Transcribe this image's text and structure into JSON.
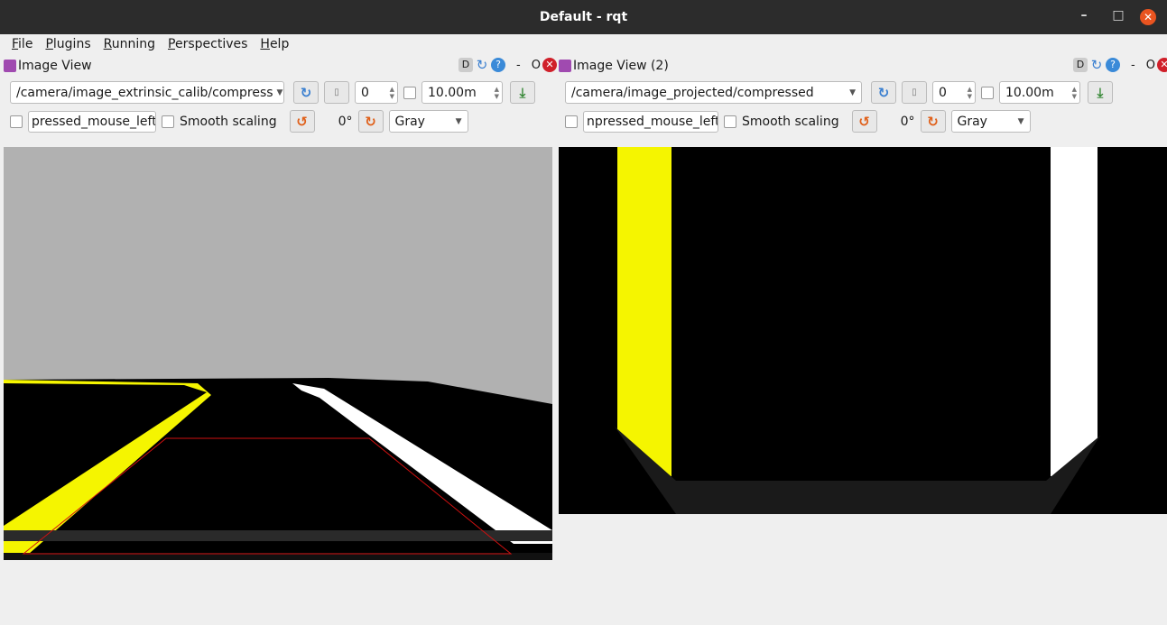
{
  "window": {
    "title": "Default - rqt",
    "minimize": "–",
    "maximize": "□",
    "close": "✕"
  },
  "menu": [
    "File",
    "Plugins",
    "Running",
    "Perspectives",
    "Help"
  ],
  "docks": [
    {
      "title": "Image View",
      "topic": "/camera/image_extrinsic_calib/compress",
      "spin_value": "0",
      "timeout": "10.00m",
      "mouse_topic": "pressed_mouse_left",
      "smooth_label": "Smooth scaling",
      "rotation": "0°",
      "color_mode": "Gray",
      "dock_buttons": {
        "d": "D",
        "help": "?",
        "minus": "-",
        "float": "O",
        "close": "✕"
      }
    },
    {
      "title": "Image View (2)",
      "topic": "/camera/image_projected/compressed",
      "spin_value": "0",
      "timeout": "10.00m",
      "mouse_topic": "npressed_mouse_left",
      "smooth_label": "Smooth scaling",
      "rotation": "0°",
      "color_mode": "Gray",
      "dock_buttons": {
        "d": "D",
        "help": "?",
        "minus": "-",
        "float": "O",
        "close": "✕"
      }
    }
  ],
  "colors": {
    "lane_yellow": "#f5f500",
    "lane_white": "#ffffff",
    "roi": "#d01010",
    "sky": "#b1b1b1"
  }
}
